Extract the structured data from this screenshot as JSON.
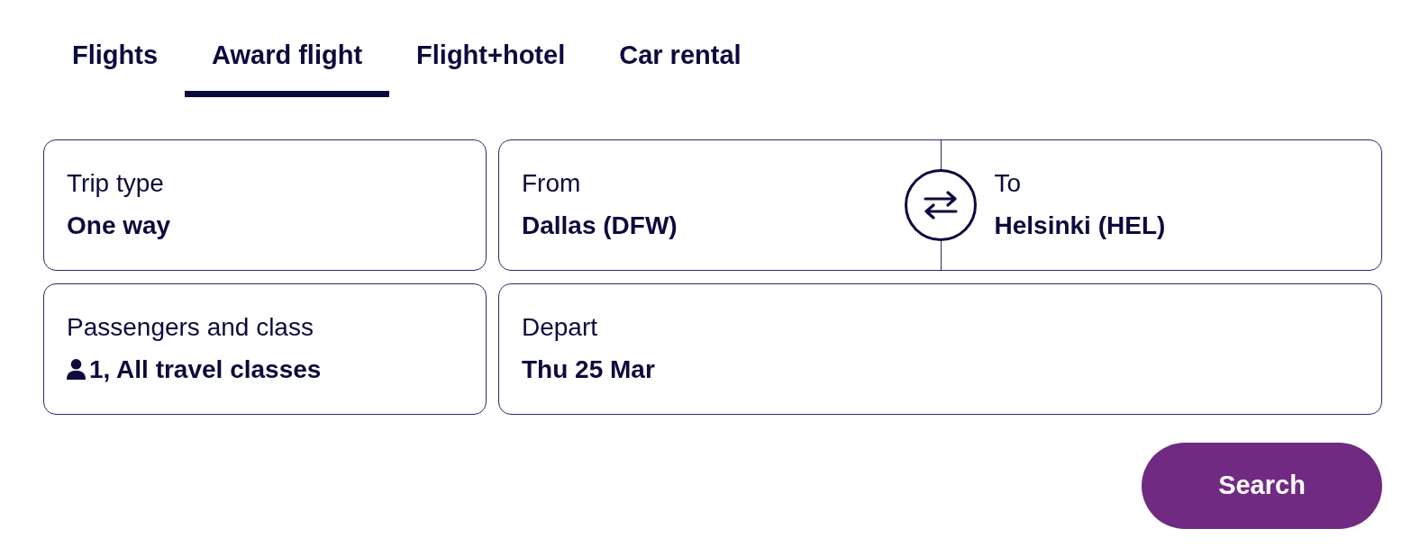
{
  "tabs": [
    {
      "label": "Flights",
      "selected": false
    },
    {
      "label": "Award flight",
      "selected": true
    },
    {
      "label": "Flight+hotel",
      "selected": false
    },
    {
      "label": "Car rental",
      "selected": false
    }
  ],
  "fields": [
    {
      "kind": "select",
      "label": "Trip type",
      "value": "One way"
    },
    {
      "kind": "route",
      "from": {
        "label": "From",
        "value": "Dallas (DFW)"
      },
      "to": {
        "label": "To",
        "value": "Helsinki (HEL)"
      }
    },
    {
      "kind": "passengers",
      "label": "Passengers and class",
      "value": "1, All travel classes"
    },
    {
      "kind": "date",
      "label": "Depart",
      "value": "Thu 25 Mar"
    }
  ],
  "search_button": {
    "label": "Search"
  }
}
